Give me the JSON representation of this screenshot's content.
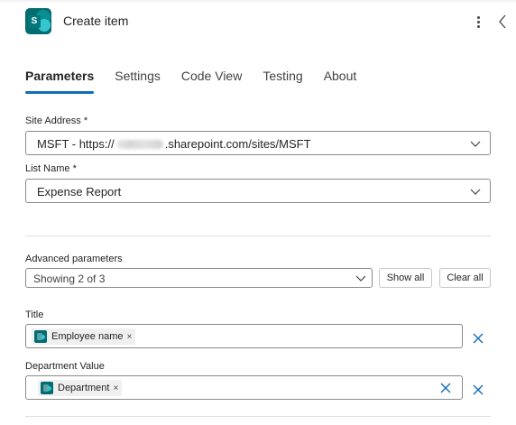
{
  "header": {
    "app_icon": "sharepoint-icon",
    "app_icon_letter": "S",
    "title": "Create item",
    "more_icon": "more-vertical-icon",
    "collapse_icon": "chevron-left-icon"
  },
  "tabs": [
    {
      "label": "Parameters",
      "active": true
    },
    {
      "label": "Settings",
      "active": false
    },
    {
      "label": "Code View",
      "active": false
    },
    {
      "label": "Testing",
      "active": false
    },
    {
      "label": "About",
      "active": false
    }
  ],
  "site_address": {
    "label": "Site Address *",
    "value_prefix": "MSFT - https://",
    "value_suffix": ".sharepoint.com/sites/MSFT",
    "redacted": true
  },
  "list_name": {
    "label": "List Name *",
    "value": "Expense Report"
  },
  "advanced": {
    "label": "Advanced parameters",
    "value": "Showing 2 of 3",
    "show_all": "Show all",
    "clear_all": "Clear all"
  },
  "fields": [
    {
      "label": "Title",
      "token": "Employee name",
      "token_remove": "×"
    },
    {
      "label": "Department Value",
      "token": "Department",
      "token_remove": "×"
    }
  ],
  "colors": {
    "accent": "#0f6cbd",
    "sharepoint": "#036c70",
    "border": "#8a8a8a",
    "divider": "#e0e0e0"
  }
}
